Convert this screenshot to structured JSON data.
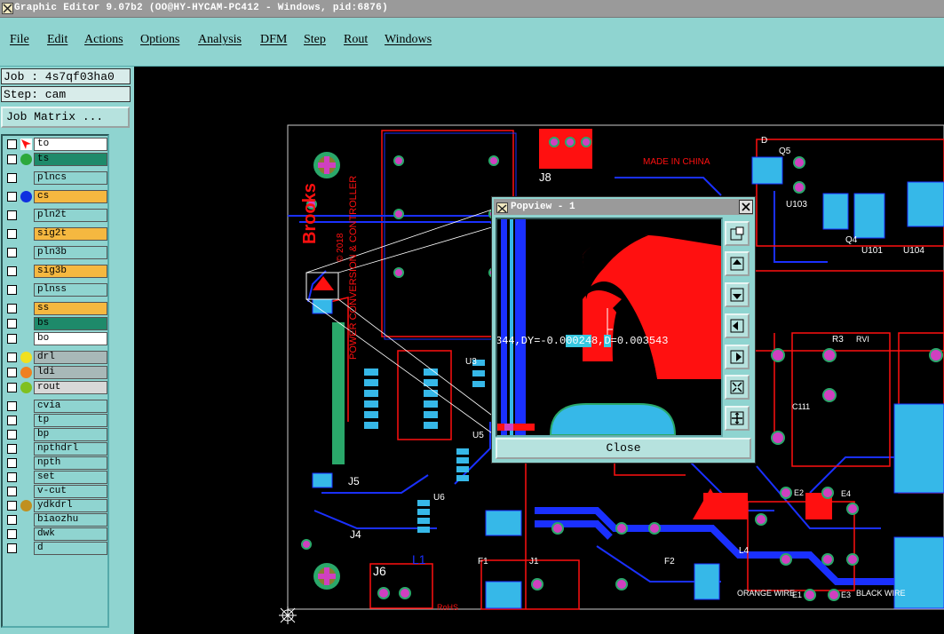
{
  "window": {
    "title": "Graphic Editor 9.07b2 (OO@HY-HYCAM-PC412 - Windows, pid:6876)"
  },
  "menu": [
    {
      "label": "File"
    },
    {
      "label": "Edit"
    },
    {
      "label": "Actions"
    },
    {
      "label": "Options"
    },
    {
      "label": "Analysis"
    },
    {
      "label": "DFM"
    },
    {
      "label": "Step"
    },
    {
      "label": "Rout"
    },
    {
      "label": "Windows"
    }
  ],
  "job": {
    "job_label": "Job : 4s7qf03ha0",
    "step_label": "Step: cam",
    "matrix_button": "Job Matrix ..."
  },
  "layers": [
    {
      "name": "to",
      "bg": "#ffffff",
      "swatch": "cursor-icon"
    },
    {
      "name": "ts",
      "bg": "#1e8a6a",
      "swatch": "#2ca83c"
    },
    {
      "name": "plncs",
      "bg": "#8fd4d0",
      "swatch": ""
    },
    {
      "name": "cs",
      "bg": "#f5b840",
      "swatch": "#1030e0"
    },
    {
      "name": "pln2t",
      "bg": "#8fd4d0",
      "swatch": ""
    },
    {
      "name": "sig2t",
      "bg": "#f5b840",
      "swatch": ""
    },
    {
      "name": "pln3b",
      "bg": "#8fd4d0",
      "swatch": ""
    },
    {
      "name": "sig3b",
      "bg": "#f5b840",
      "swatch": ""
    },
    {
      "name": "plnss",
      "bg": "#8fd4d0",
      "swatch": ""
    },
    {
      "name": "ss",
      "bg": "#f5b840",
      "swatch": ""
    },
    {
      "name": "bs",
      "bg": "#1e8a6a",
      "swatch": ""
    },
    {
      "name": "bo",
      "bg": "#ffffff",
      "swatch": ""
    },
    {
      "name": "drl",
      "bg": "#a8b8b8",
      "swatch": "#f0e020"
    },
    {
      "name": "ldi",
      "bg": "#a8b8b8",
      "swatch": "#f08020"
    },
    {
      "name": "rout",
      "bg": "#d8d8d8",
      "swatch": "#80c020"
    },
    {
      "name": "cvia",
      "bg": "#8fd4d0",
      "swatch": ""
    },
    {
      "name": "tp",
      "bg": "#8fd4d0",
      "swatch": ""
    },
    {
      "name": "bp",
      "bg": "#8fd4d0",
      "swatch": ""
    },
    {
      "name": "npthdrl",
      "bg": "#8fd4d0",
      "swatch": ""
    },
    {
      "name": "npth",
      "bg": "#8fd4d0",
      "swatch": ""
    },
    {
      "name": "set",
      "bg": "#8fd4d0",
      "swatch": ""
    },
    {
      "name": "v-cut",
      "bg": "#8fd4d0",
      "swatch": ""
    },
    {
      "name": "ydkdrl",
      "bg": "#8fd4d0",
      "swatch": "#c09020"
    },
    {
      "name": "biaozhu",
      "bg": "#8fd4d0",
      "swatch": ""
    },
    {
      "name": "dwk",
      "bg": "#8fd4d0",
      "swatch": ""
    },
    {
      "name": "d",
      "bg": "#8fd4d0",
      "swatch": ""
    }
  ],
  "popview": {
    "title": "Popview - 1",
    "coord_prefix": "344,DY=-0.0",
    "coord_hl1": "0024",
    "coord_mid": "8,",
    "coord_hl2": "D",
    "coord_suffix": "=0.003543",
    "close_label": "Close",
    "tools": [
      "zoom-fit-icon",
      "pan-up-icon",
      "pan-down-icon",
      "pan-left-icon",
      "pan-right-icon",
      "zoom-in-icon",
      "zoom-out-icon"
    ]
  },
  "board": {
    "silk_labels": [
      "J8",
      "J6",
      "J5",
      "J4",
      "J1",
      "F1",
      "F2",
      "L1",
      "L4",
      "U5",
      "U6",
      "U3",
      "Q5",
      "Q4",
      "U101",
      "U103",
      "U104",
      "R3",
      "E2",
      "E3",
      "E4",
      "E1",
      "C111",
      "RVI",
      "D"
    ],
    "brand": "Brooks",
    "brand_sub": "POWER CONVERSION & CONTROLLER",
    "copyright": "© 2018",
    "made_in": "MADE IN CHINA",
    "rohs": "RoHS",
    "orange_wire": "ORANGE WIRE",
    "black_wire": "BLACK WIRE"
  },
  "colors": {
    "chrome": "#8fd4d0",
    "title_bar": "#9a9a9a",
    "copper_red": "#ff1010",
    "copper_blue": "#1a30ff",
    "pad_cyan": "#36b8e8",
    "pad_magenta": "#d040c0"
  }
}
